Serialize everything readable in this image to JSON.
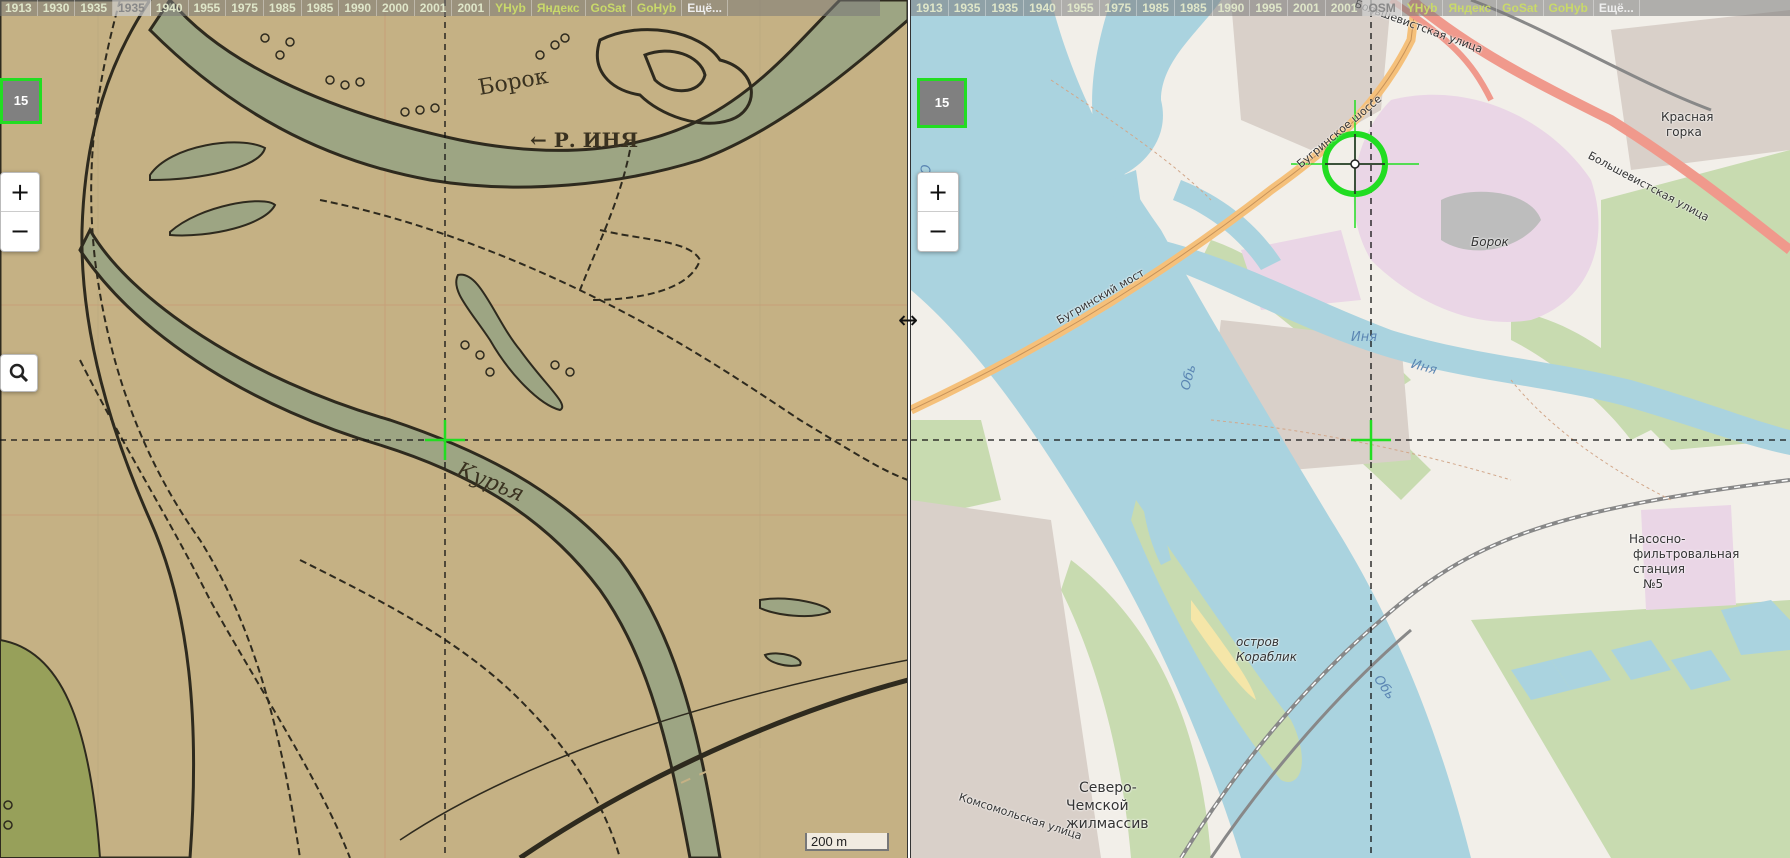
{
  "left_map": {
    "year_tabs": [
      {
        "label": "1913",
        "active": false
      },
      {
        "label": "1930",
        "active": false
      },
      {
        "label": "1935",
        "active": false
      },
      {
        "label": "1935",
        "active": true
      },
      {
        "label": "1940",
        "active": false
      },
      {
        "label": "1955",
        "active": false
      },
      {
        "label": "1975",
        "active": false
      },
      {
        "label": "1985",
        "active": false
      },
      {
        "label": "1985",
        "active": false
      },
      {
        "label": "1990",
        "active": false
      },
      {
        "label": "2000",
        "active": false
      },
      {
        "label": "2001",
        "active": false
      },
      {
        "label": "2001",
        "active": false
      }
    ],
    "layer_tabs": [
      "YHyb",
      "Яндекс",
      "GoSat",
      "GoHyb"
    ],
    "more_label": "Ещё...",
    "zoom_level": "15",
    "zoom_in": "+",
    "zoom_out": "−",
    "scale_label": "200 m",
    "labels": {
      "borok": "Борок",
      "river_inya": "← Р. ИНЯ",
      "kurya": "Курья"
    }
  },
  "right_map": {
    "year_tabs": [
      {
        "label": "1913",
        "active": false
      },
      {
        "label": "1935",
        "active": false
      },
      {
        "label": "1935",
        "active": false
      },
      {
        "label": "1940",
        "active": false
      },
      {
        "label": "1955",
        "active": false
      },
      {
        "label": "1975",
        "active": false
      },
      {
        "label": "1985",
        "active": false
      },
      {
        "label": "1985",
        "active": false
      },
      {
        "label": "1990",
        "active": false
      },
      {
        "label": "1995",
        "active": false
      },
      {
        "label": "2001",
        "active": false
      },
      {
        "label": "2001",
        "active": false
      },
      {
        "label": "OSM",
        "active": true
      }
    ],
    "layer_tabs": [
      "YHyb",
      "Яндекс",
      "GoSat",
      "GoHyb"
    ],
    "more_label": "Ещё...",
    "zoom_level": "15",
    "zoom_in": "+",
    "zoom_out": "−",
    "labels": {
      "street_bolshevistskaya_top": "Большевистская улица",
      "street_bolshevistskaya_right": "Большевистская улица",
      "bugrinskoye_shosse": "Бугринское шоссе",
      "bugrinsky_most": "Бугринский мост",
      "krasnaya_gorka_1": "Красная",
      "krasnaya_gorka_2": "горка",
      "borok": "Борок",
      "inya_1": "Иня",
      "inya_2": "Иня",
      "ob_1": "Обь",
      "ob_2": "Обь",
      "ob_3": "Обь",
      "island_1": "остров",
      "island_2": "Кораблик",
      "station_1": "Насосно-",
      "station_2": "фильтровальная",
      "station_3": "станция",
      "station_4": "№5",
      "district_1": "Северо-",
      "district_2": "Чемской",
      "district_3": "жилмассив",
      "komsomolskaya": "Комсомольская улица"
    }
  },
  "colors": {
    "old_map_paper": "#c5b184",
    "osm_land": "#f2efe9",
    "osm_water": "#aad3df",
    "crosshair": "#22dd22"
  }
}
